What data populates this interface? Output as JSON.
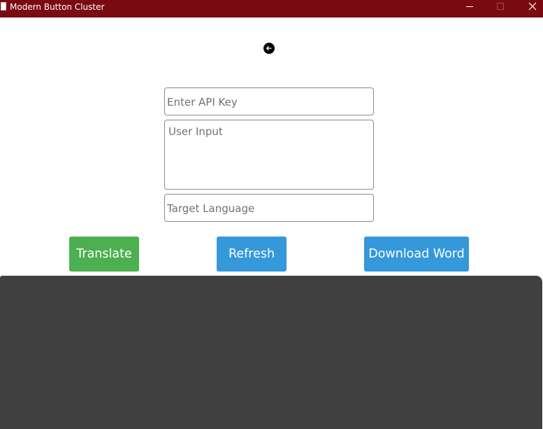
{
  "window": {
    "title": "Modern Button Cluster",
    "icon": "document-icon",
    "controls": [
      "minimize-icon",
      "maximize-icon",
      "close-icon"
    ],
    "titlebar_color": "#7a0a12"
  },
  "nav": {
    "back_icon": "arrow-left-circle-icon"
  },
  "form": {
    "api_key_placeholder": "Enter API Key",
    "user_input_placeholder": "User Input",
    "target_language_placeholder": "Target Language"
  },
  "buttons": {
    "translate": "Translate",
    "refresh": "Refresh",
    "download_word": "Download Word"
  },
  "colors": {
    "translate": "#4caf50",
    "refresh": "#3498db",
    "download_word": "#3498db",
    "output_panel": "#404040"
  },
  "output": {
    "text": ""
  }
}
